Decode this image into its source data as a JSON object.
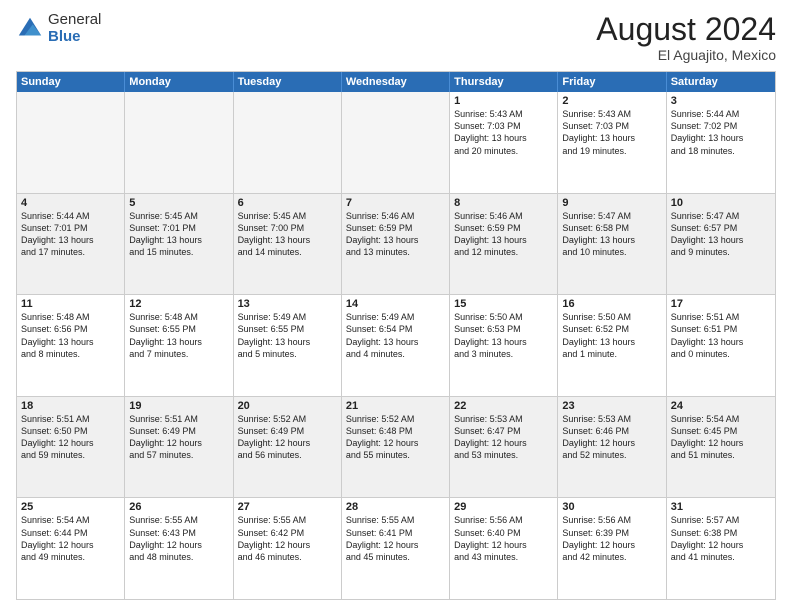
{
  "logo": {
    "general": "General",
    "blue": "Blue"
  },
  "header": {
    "month_year": "August 2024",
    "location": "El Aguajito, Mexico"
  },
  "weekdays": [
    "Sunday",
    "Monday",
    "Tuesday",
    "Wednesday",
    "Thursday",
    "Friday",
    "Saturday"
  ],
  "weeks": [
    [
      {
        "day": "",
        "detail": ""
      },
      {
        "day": "",
        "detail": ""
      },
      {
        "day": "",
        "detail": ""
      },
      {
        "day": "",
        "detail": ""
      },
      {
        "day": "1",
        "detail": "Sunrise: 5:43 AM\nSunset: 7:03 PM\nDaylight: 13 hours\nand 20 minutes."
      },
      {
        "day": "2",
        "detail": "Sunrise: 5:43 AM\nSunset: 7:03 PM\nDaylight: 13 hours\nand 19 minutes."
      },
      {
        "day": "3",
        "detail": "Sunrise: 5:44 AM\nSunset: 7:02 PM\nDaylight: 13 hours\nand 18 minutes."
      }
    ],
    [
      {
        "day": "4",
        "detail": "Sunrise: 5:44 AM\nSunset: 7:01 PM\nDaylight: 13 hours\nand 17 minutes."
      },
      {
        "day": "5",
        "detail": "Sunrise: 5:45 AM\nSunset: 7:01 PM\nDaylight: 13 hours\nand 15 minutes."
      },
      {
        "day": "6",
        "detail": "Sunrise: 5:45 AM\nSunset: 7:00 PM\nDaylight: 13 hours\nand 14 minutes."
      },
      {
        "day": "7",
        "detail": "Sunrise: 5:46 AM\nSunset: 6:59 PM\nDaylight: 13 hours\nand 13 minutes."
      },
      {
        "day": "8",
        "detail": "Sunrise: 5:46 AM\nSunset: 6:59 PM\nDaylight: 13 hours\nand 12 minutes."
      },
      {
        "day": "9",
        "detail": "Sunrise: 5:47 AM\nSunset: 6:58 PM\nDaylight: 13 hours\nand 10 minutes."
      },
      {
        "day": "10",
        "detail": "Sunrise: 5:47 AM\nSunset: 6:57 PM\nDaylight: 13 hours\nand 9 minutes."
      }
    ],
    [
      {
        "day": "11",
        "detail": "Sunrise: 5:48 AM\nSunset: 6:56 PM\nDaylight: 13 hours\nand 8 minutes."
      },
      {
        "day": "12",
        "detail": "Sunrise: 5:48 AM\nSunset: 6:55 PM\nDaylight: 13 hours\nand 7 minutes."
      },
      {
        "day": "13",
        "detail": "Sunrise: 5:49 AM\nSunset: 6:55 PM\nDaylight: 13 hours\nand 5 minutes."
      },
      {
        "day": "14",
        "detail": "Sunrise: 5:49 AM\nSunset: 6:54 PM\nDaylight: 13 hours\nand 4 minutes."
      },
      {
        "day": "15",
        "detail": "Sunrise: 5:50 AM\nSunset: 6:53 PM\nDaylight: 13 hours\nand 3 minutes."
      },
      {
        "day": "16",
        "detail": "Sunrise: 5:50 AM\nSunset: 6:52 PM\nDaylight: 13 hours\nand 1 minute."
      },
      {
        "day": "17",
        "detail": "Sunrise: 5:51 AM\nSunset: 6:51 PM\nDaylight: 13 hours\nand 0 minutes."
      }
    ],
    [
      {
        "day": "18",
        "detail": "Sunrise: 5:51 AM\nSunset: 6:50 PM\nDaylight: 12 hours\nand 59 minutes."
      },
      {
        "day": "19",
        "detail": "Sunrise: 5:51 AM\nSunset: 6:49 PM\nDaylight: 12 hours\nand 57 minutes."
      },
      {
        "day": "20",
        "detail": "Sunrise: 5:52 AM\nSunset: 6:49 PM\nDaylight: 12 hours\nand 56 minutes."
      },
      {
        "day": "21",
        "detail": "Sunrise: 5:52 AM\nSunset: 6:48 PM\nDaylight: 12 hours\nand 55 minutes."
      },
      {
        "day": "22",
        "detail": "Sunrise: 5:53 AM\nSunset: 6:47 PM\nDaylight: 12 hours\nand 53 minutes."
      },
      {
        "day": "23",
        "detail": "Sunrise: 5:53 AM\nSunset: 6:46 PM\nDaylight: 12 hours\nand 52 minutes."
      },
      {
        "day": "24",
        "detail": "Sunrise: 5:54 AM\nSunset: 6:45 PM\nDaylight: 12 hours\nand 51 minutes."
      }
    ],
    [
      {
        "day": "25",
        "detail": "Sunrise: 5:54 AM\nSunset: 6:44 PM\nDaylight: 12 hours\nand 49 minutes."
      },
      {
        "day": "26",
        "detail": "Sunrise: 5:55 AM\nSunset: 6:43 PM\nDaylight: 12 hours\nand 48 minutes."
      },
      {
        "day": "27",
        "detail": "Sunrise: 5:55 AM\nSunset: 6:42 PM\nDaylight: 12 hours\nand 46 minutes."
      },
      {
        "day": "28",
        "detail": "Sunrise: 5:55 AM\nSunset: 6:41 PM\nDaylight: 12 hours\nand 45 minutes."
      },
      {
        "day": "29",
        "detail": "Sunrise: 5:56 AM\nSunset: 6:40 PM\nDaylight: 12 hours\nand 43 minutes."
      },
      {
        "day": "30",
        "detail": "Sunrise: 5:56 AM\nSunset: 6:39 PM\nDaylight: 12 hours\nand 42 minutes."
      },
      {
        "day": "31",
        "detail": "Sunrise: 5:57 AM\nSunset: 6:38 PM\nDaylight: 12 hours\nand 41 minutes."
      }
    ]
  ]
}
